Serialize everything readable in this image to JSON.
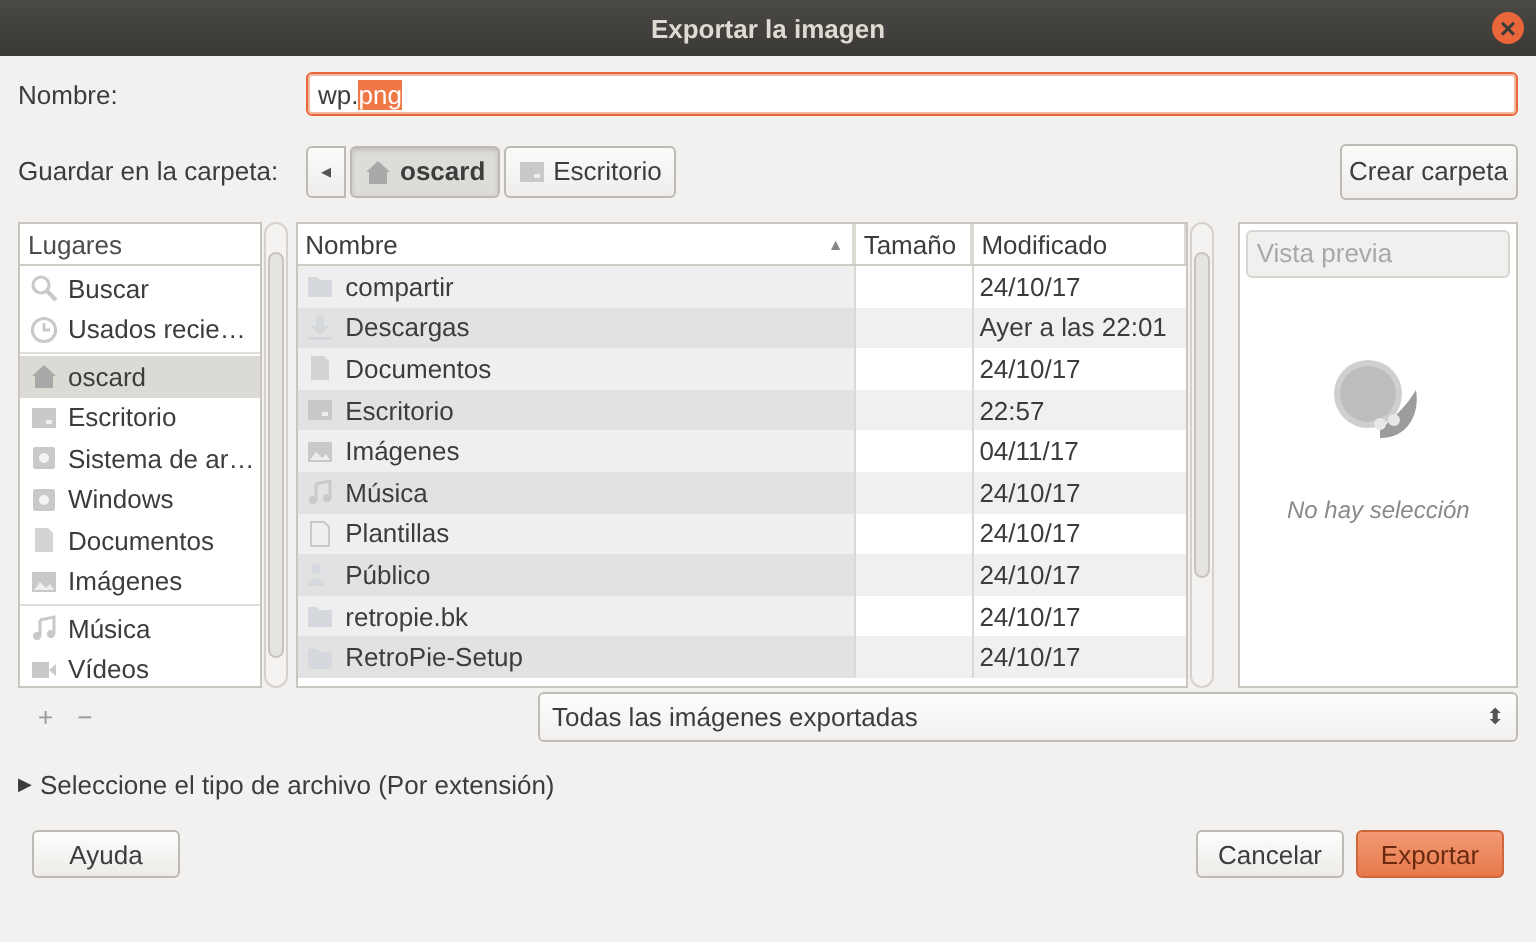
{
  "window": {
    "title": "Exportar la imagen",
    "close": "×"
  },
  "name_field": {
    "label": "Nombre:",
    "value_base": "wp.",
    "value_selected": "png"
  },
  "folder_path": {
    "label": "Guardar en la carpeta:",
    "back": "◂",
    "crumbs": [
      {
        "label": "oscard",
        "kind": "home",
        "selected": true
      },
      {
        "label": "Escritorio",
        "kind": "desktop",
        "selected": false
      }
    ]
  },
  "create_folder": "Crear carpeta",
  "places": {
    "header": "Lugares",
    "groups": [
      [
        {
          "label": "Buscar",
          "kind": "search",
          "selected": false
        },
        {
          "label": "Usados recie…",
          "kind": "clock",
          "selected": false
        }
      ],
      [
        {
          "label": "oscard",
          "kind": "home",
          "selected": true
        },
        {
          "label": "Escritorio",
          "kind": "desktop",
          "selected": false
        },
        {
          "label": "Sistema de ar…",
          "kind": "drive",
          "selected": false
        },
        {
          "label": "Windows",
          "kind": "drive",
          "selected": false
        },
        {
          "label": "Documentos",
          "kind": "document",
          "selected": false
        },
        {
          "label": "Imágenes",
          "kind": "image",
          "selected": false
        }
      ],
      [
        {
          "label": "Música",
          "kind": "music",
          "selected": false
        },
        {
          "label": "Vídeos",
          "kind": "video",
          "selected": false
        }
      ]
    ],
    "add": "+",
    "remove": "−"
  },
  "table": {
    "columns": [
      "Nombre",
      "Tamaño",
      "Modificado"
    ],
    "sort_arrow": "▲",
    "rows": [
      {
        "name": "compartir",
        "kind": "folder",
        "modified": "24/10/17"
      },
      {
        "name": "Descargas",
        "kind": "download",
        "modified": "Ayer a las 22:01"
      },
      {
        "name": "Documentos",
        "kind": "document",
        "modified": "24/10/17"
      },
      {
        "name": "Escritorio",
        "kind": "desktop",
        "modified": "22:57"
      },
      {
        "name": "Imágenes",
        "kind": "image",
        "modified": "04/11/17"
      },
      {
        "name": "Música",
        "kind": "music",
        "modified": "24/10/17"
      },
      {
        "name": "Plantillas",
        "kind": "template",
        "modified": "24/10/17"
      },
      {
        "name": "Público",
        "kind": "public",
        "modified": "24/10/17"
      },
      {
        "name": "retropie.bk",
        "kind": "folder",
        "modified": "24/10/17"
      },
      {
        "name": "RetroPie-Setup",
        "kind": "folder",
        "modified": "24/10/17"
      }
    ]
  },
  "preview": {
    "header": "Vista previa",
    "message": "No hay selección"
  },
  "filter": {
    "value": "Todas las imágenes exportadas",
    "arrows": "⬍"
  },
  "file_type": {
    "arrow": "▶",
    "label": "Seleccione el tipo de archivo (Por extensión)",
    "expanded": false
  },
  "buttons": [
    {
      "label": "Ayuda",
      "kind": "normal"
    },
    {
      "label": "Cancelar",
      "kind": "normal"
    },
    {
      "label": "Exportar",
      "kind": "primary"
    }
  ]
}
